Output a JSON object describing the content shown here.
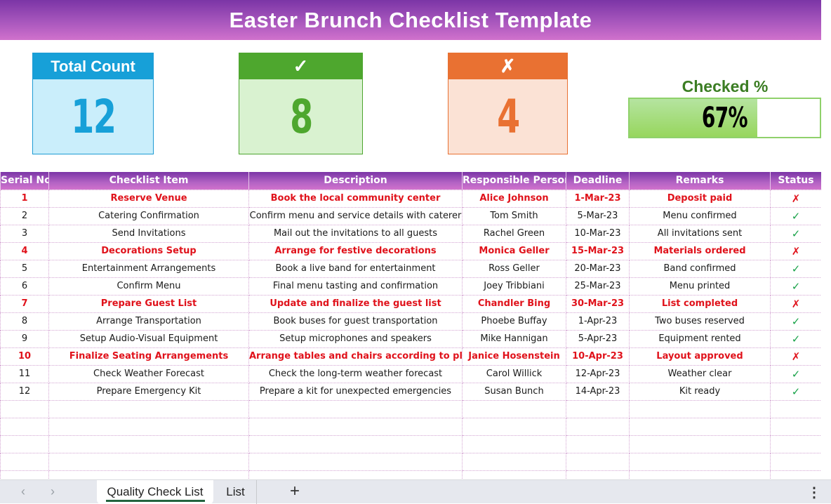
{
  "title": "Easter Brunch Checklist Template",
  "kpis": {
    "total": {
      "label": "Total Count",
      "value": "12"
    },
    "checked": {
      "label": "✓",
      "value": "8"
    },
    "unchecked": {
      "label": "✗",
      "value": "4"
    },
    "percent": {
      "label": "Checked %",
      "value": "67%",
      "fraction": 0.67
    }
  },
  "table": {
    "headers": [
      "Serial No.",
      "Checklist Item",
      "Description",
      "Responsible Person",
      "Deadline",
      "Remarks",
      "Status"
    ],
    "rows": [
      {
        "serial": "1",
        "item": "Reserve Venue",
        "description": "Book the local community center",
        "person": "Alice Johnson",
        "deadline": "1-Mar-23",
        "remarks": "Deposit paid",
        "status": "✗",
        "done": false
      },
      {
        "serial": "2",
        "item": "Catering Confirmation",
        "description": "Confirm menu and service details with caterer",
        "person": "Tom Smith",
        "deadline": "5-Mar-23",
        "remarks": "Menu confirmed",
        "status": "✓",
        "done": true
      },
      {
        "serial": "3",
        "item": "Send Invitations",
        "description": "Mail out the invitations to all guests",
        "person": "Rachel Green",
        "deadline": "10-Mar-23",
        "remarks": "All invitations sent",
        "status": "✓",
        "done": true
      },
      {
        "serial": "4",
        "item": "Decorations Setup",
        "description": "Arrange for festive decorations",
        "person": "Monica Geller",
        "deadline": "15-Mar-23",
        "remarks": "Materials ordered",
        "status": "✗",
        "done": false
      },
      {
        "serial": "5",
        "item": "Entertainment Arrangements",
        "description": "Book a live band for entertainment",
        "person": "Ross Geller",
        "deadline": "20-Mar-23",
        "remarks": "Band confirmed",
        "status": "✓",
        "done": true
      },
      {
        "serial": "6",
        "item": "Confirm Menu",
        "description": "Final menu tasting and confirmation",
        "person": "Joey Tribbiani",
        "deadline": "25-Mar-23",
        "remarks": "Menu printed",
        "status": "✓",
        "done": true
      },
      {
        "serial": "7",
        "item": "Prepare Guest List",
        "description": "Update and finalize the guest list",
        "person": "Chandler Bing",
        "deadline": "30-Mar-23",
        "remarks": "List completed",
        "status": "✗",
        "done": false
      },
      {
        "serial": "8",
        "item": "Arrange Transportation",
        "description": "Book buses for guest transportation",
        "person": "Phoebe Buffay",
        "deadline": "1-Apr-23",
        "remarks": "Two buses reserved",
        "status": "✓",
        "done": true
      },
      {
        "serial": "9",
        "item": "Setup Audio-Visual Equipment",
        "description": "Setup microphones and speakers",
        "person": "Mike Hannigan",
        "deadline": "5-Apr-23",
        "remarks": "Equipment rented",
        "status": "✓",
        "done": true
      },
      {
        "serial": "10",
        "item": "Finalize Seating Arrangements",
        "description": "Arrange tables and chairs according to plan",
        "person": "Janice Hosenstein",
        "deadline": "10-Apr-23",
        "remarks": "Layout approved",
        "status": "✗",
        "done": false
      },
      {
        "serial": "11",
        "item": "Check Weather Forecast",
        "description": "Check the long-term weather forecast",
        "person": "Carol Willick",
        "deadline": "12-Apr-23",
        "remarks": "Weather clear",
        "status": "✓",
        "done": true
      },
      {
        "serial": "12",
        "item": "Prepare Emergency Kit",
        "description": "Prepare a kit for unexpected emergencies",
        "person": "Susan Bunch",
        "deadline": "14-Apr-23",
        "remarks": "Kit ready",
        "status": "✓",
        "done": true
      }
    ],
    "empty_rows": 5
  },
  "tabs": {
    "prev_icon": "‹",
    "next_icon": "›",
    "sheets": [
      "Quality Check List",
      "List"
    ],
    "active": "Quality Check List",
    "add_icon": "+",
    "more_icon": "⋮"
  }
}
